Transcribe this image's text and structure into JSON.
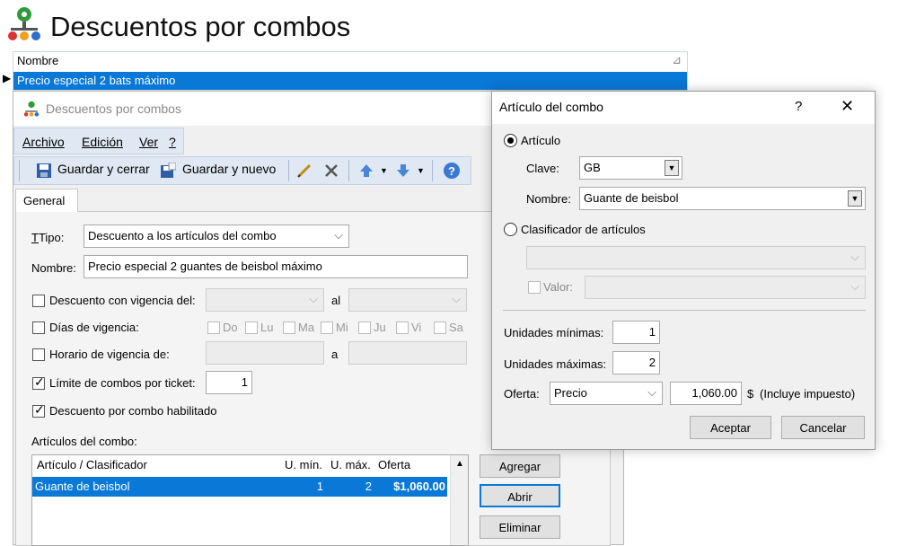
{
  "app": {
    "title": "Descuentos por combos"
  },
  "background_list": {
    "column_header": "Nombre",
    "selected_row": "Precio especial 2 bats máximo"
  },
  "editor": {
    "window_title": "Descuentos por combos",
    "menu": [
      "Archivo",
      "Edición",
      "Ver",
      "?"
    ],
    "toolbar": {
      "save_close": "Guardar y cerrar",
      "save_new": "Guardar y nuevo"
    },
    "tab": "General",
    "tipo_label": "Tipo:",
    "tipo_value": "Descuento a los artículos del combo",
    "nombre_label": "Nombre:",
    "nombre_value": "Precio especial 2 guantes de beisbol máximo",
    "vigencia_label": "Descuento con vigencia del:",
    "vigencia_al": "al",
    "dias_label": "Días de vigencia:",
    "days": [
      "Do",
      "Lu",
      "Ma",
      "Mi",
      "Ju",
      "Vi",
      "Sa"
    ],
    "horario_label": "Horario de vigencia de:",
    "horario_a": "a",
    "limite_label": "Límite de combos por ticket:",
    "limite_value": "1",
    "habilitado_label": "Descuento por combo habilitado",
    "articulos_label": "Artículos del combo:",
    "grid": {
      "headers": [
        "Artículo / Clasificador",
        "U. mín.",
        "U. máx.",
        "Oferta"
      ],
      "row": {
        "articulo": "Guante de beisbol",
        "umin": "1",
        "umax": "2",
        "oferta": "$1,060.00"
      }
    },
    "buttons": {
      "agregar": "Agregar",
      "abrir": "Abrir",
      "eliminar": "Eliminar"
    }
  },
  "dialog": {
    "title": "Artículo del combo",
    "help": "?",
    "close": "✕",
    "articulo_radio": "Artículo",
    "clave_label": "Clave:",
    "clave_value": "GB",
    "nombre_label": "Nombre:",
    "nombre_value": "Guante de beisbol",
    "clasificador_radio": "Clasificador de artículos",
    "valor_label": "Valor:",
    "unid_min_label": "Unidades mínimas:",
    "unid_min_value": "1",
    "unid_max_label": "Unidades máximas:",
    "unid_max_value": "2",
    "oferta_label": "Oferta:",
    "oferta_tipo": "Precio",
    "oferta_value": "1,060.00",
    "currency": "$",
    "impuesto": "(Incluye impuesto)",
    "aceptar": "Aceptar",
    "cancelar": "Cancelar"
  },
  "colors": {
    "selection": "#0a78d7",
    "toolbar": "#dfe8f3"
  }
}
